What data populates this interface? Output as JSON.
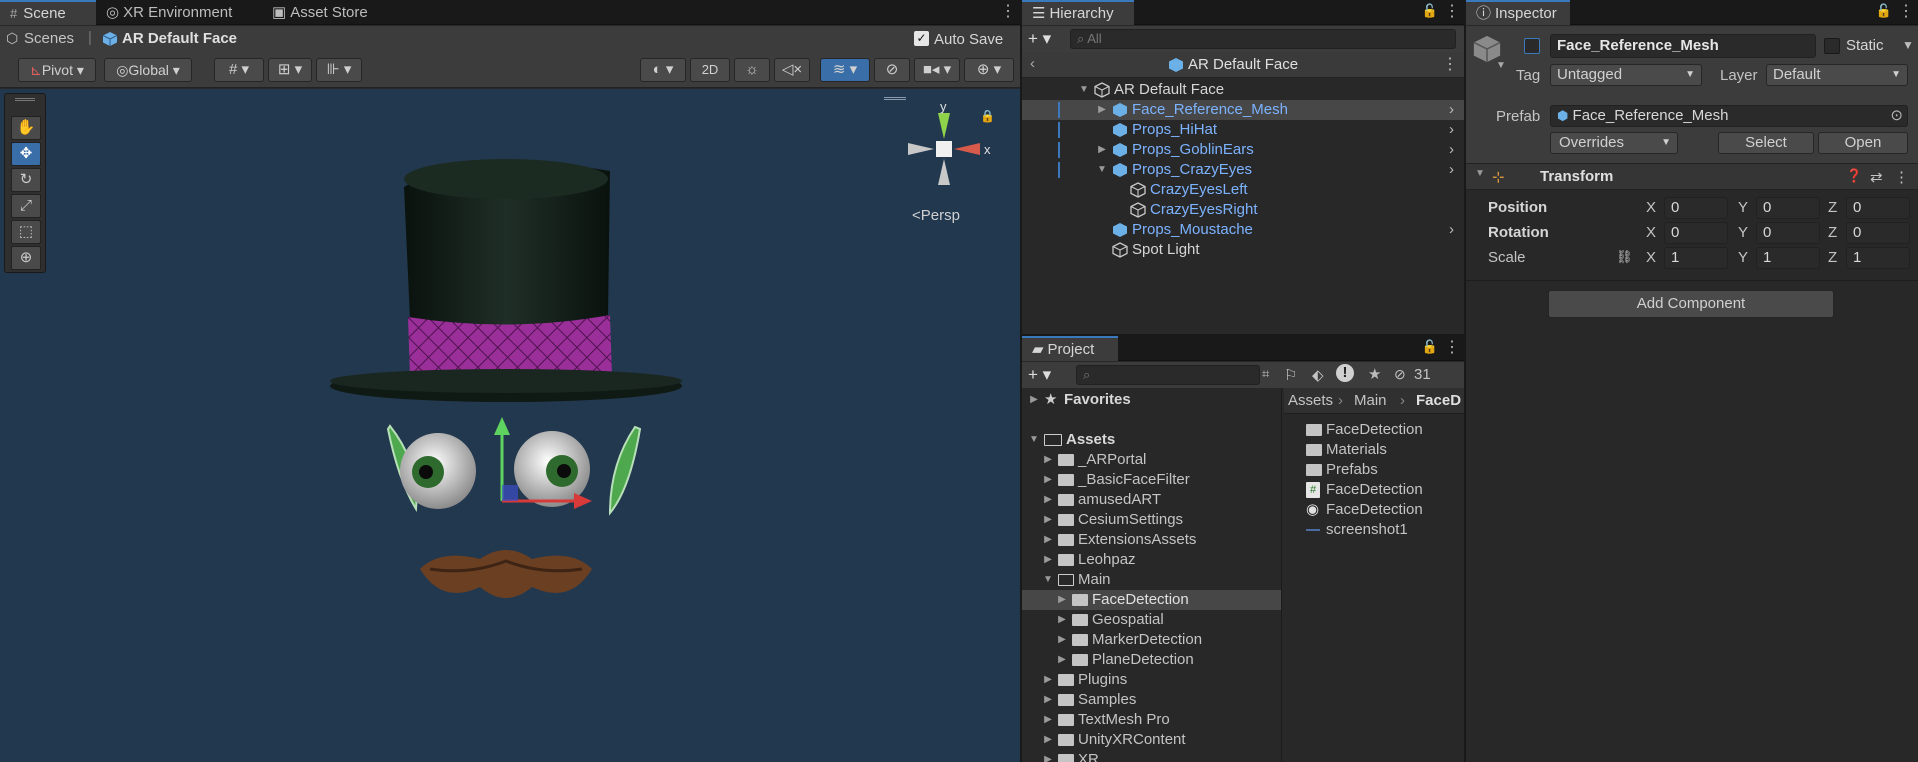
{
  "scene_panel": {
    "tabs": [
      "Scene",
      "XR Environment",
      "Asset Store"
    ],
    "breadcrumb_root": "Scenes",
    "breadcrumb_current": "AR Default Face",
    "auto_save_label": "Auto Save",
    "auto_save_checked": true,
    "pivot_label": "Pivot",
    "global_label": "Global",
    "mode_2d_label": "2D",
    "gizmo_axes": {
      "y": "y",
      "x": "x"
    },
    "persp_label": "<Persp"
  },
  "hierarchy": {
    "tab": "Hierarchy",
    "search_placeholder": "All",
    "header_title": "AR Default Face",
    "items": [
      {
        "label": "AR Default Face"
      },
      {
        "label": "Face_Reference_Mesh"
      },
      {
        "label": "Props_HiHat"
      },
      {
        "label": "Props_GoblinEars"
      },
      {
        "label": "Props_CrazyEyes"
      },
      {
        "label": "CrazyEyesLeft"
      },
      {
        "label": "CrazyEyesRight"
      },
      {
        "label": "Props_Moustache"
      },
      {
        "label": "Spot Light"
      }
    ]
  },
  "project": {
    "tab": "Project",
    "hidden_count": "31",
    "favorites_label": "Favorites",
    "assets_label": "Assets",
    "tree": [
      {
        "label": "_ARPortal"
      },
      {
        "label": "_BasicFaceFilter"
      },
      {
        "label": "amusedART"
      },
      {
        "label": "CesiumSettings"
      },
      {
        "label": "ExtensionsAssets"
      },
      {
        "label": "Leohpaz"
      },
      {
        "label": "Main"
      },
      {
        "label": "FaceDetection"
      },
      {
        "label": "Geospatial"
      },
      {
        "label": "MarkerDetection"
      },
      {
        "label": "PlaneDetection"
      },
      {
        "label": "Plugins"
      },
      {
        "label": "Samples"
      },
      {
        "label": "TextMesh Pro"
      },
      {
        "label": "UnityXRContent"
      },
      {
        "label": "XR"
      }
    ],
    "path": [
      "Assets",
      "Main",
      "FaceD"
    ],
    "files": [
      {
        "label": "FaceDetection"
      },
      {
        "label": "Materials"
      },
      {
        "label": "Prefabs"
      },
      {
        "label": "FaceDetection"
      },
      {
        "label": "FaceDetection"
      },
      {
        "label": "screenshot1"
      }
    ]
  },
  "inspector": {
    "tab": "Inspector",
    "object_name": "Face_Reference_Mesh",
    "static_label": "Static",
    "tag_label": "Tag",
    "tag_value": "Untagged",
    "layer_label": "Layer",
    "layer_value": "Default",
    "prefab_label": "Prefab",
    "prefab_value": "Face_Reference_Mesh",
    "overrides_label": "Overrides",
    "select_label": "Select",
    "open_label": "Open",
    "transform_title": "Transform",
    "position_label": "Position",
    "rotation_label": "Rotation",
    "scale_label": "Scale",
    "axis_x": "X",
    "axis_y": "Y",
    "axis_z": "Z",
    "position": {
      "x": "0",
      "y": "0",
      "z": "0"
    },
    "rotation": {
      "x": "0",
      "y": "0",
      "z": "0"
    },
    "scale": {
      "x": "1",
      "y": "1",
      "z": "1"
    },
    "add_component_label": "Add Component"
  },
  "colors": {
    "accent": "#3a79bb",
    "prefab_blue": "#7cb3ff",
    "viewport_bg": "#22384f",
    "hat_band": "#8a2a8a"
  }
}
